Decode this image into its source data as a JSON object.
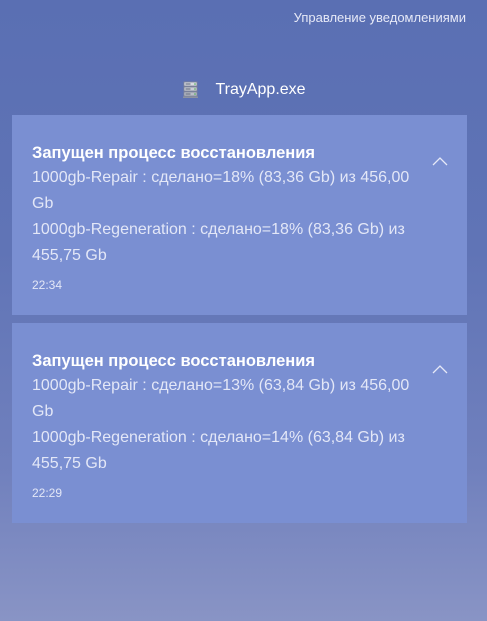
{
  "header": {
    "manage_notifications": "Управление уведомлениями"
  },
  "app": {
    "name": "TrayApp.exe",
    "icon": "server-stack-icon"
  },
  "notifications": [
    {
      "title": "Запущен процесс восстановления",
      "line1": "1000gb-Repair : сделано=18% (83,36 Gb) из 456,00 Gb",
      "line2": "1000gb-Regeneration : сделано=18% (83,36 Gb) из 455,75 Gb",
      "time": "22:34",
      "collapse_icon": "chevron-up-icon"
    },
    {
      "title": "Запущен процесс восстановления",
      "line1": "1000gb-Repair : сделано=13% (63,84 Gb) из 456,00 Gb",
      "line2": "1000gb-Regeneration : сделано=14% (63,84 Gb) из 455,75 Gb",
      "time": "22:29",
      "collapse_icon": "chevron-up-icon"
    }
  ],
  "colors": {
    "background": "#6074b6",
    "card": "#7a8fd2",
    "text": "#ffffff"
  }
}
